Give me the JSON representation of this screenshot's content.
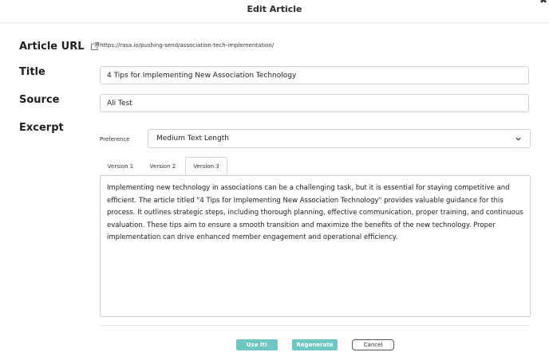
{
  "modal": {
    "title": "Edit Article",
    "close_icon": "close-icon"
  },
  "article_url": {
    "label": "Article URL",
    "icon": "external-link-icon",
    "value": "https://rasa.io/pushing-send/association-tech-implementation/"
  },
  "title_field": {
    "label": "Title",
    "value": "4 Tips for Implementing New Association Technology"
  },
  "source_field": {
    "label": "Source",
    "value": "Ali Test"
  },
  "excerpt": {
    "label": "Excerpt",
    "preference_label": "Preference",
    "preference_value": "Medium Text Length",
    "tabs": [
      {
        "label": "Version 1",
        "active": false
      },
      {
        "label": "Version 2",
        "active": false
      },
      {
        "label": "Version 3",
        "active": true
      }
    ],
    "text": "Implementing new technology in associations can be a challenging task, but it is essential for staying competitive and efficient. The article titled \"4 Tips for Implementing New Association Technology\" provides valuable guidance for this process. It outlines strategic steps, including thorough planning, effective communication, proper training, and continuous evaluation. These tips aim to ensure a smooth transition and maximize the benefits of the new technology. Proper implementation can drive enhanced member engagement and operational efficiency."
  },
  "actions": {
    "use_it": "Use It!",
    "regenerate": "Regenerate",
    "cancel": "Cancel"
  },
  "colors": {
    "accent": "#6fc7c4"
  }
}
